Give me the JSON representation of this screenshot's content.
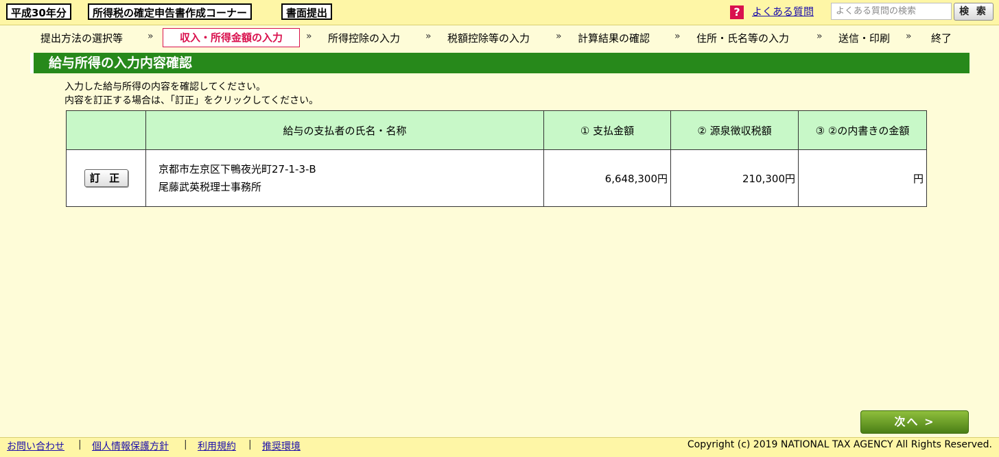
{
  "header": {
    "tags": [
      "平成30年分",
      "所得税の確定申告書作成コーナー",
      "書面提出"
    ],
    "help_icon": "question-mark-icon",
    "help_symbol": "?",
    "faq_link": "よくある質問",
    "search_placeholder": "よくある質問の検索",
    "search_button": "検 索"
  },
  "steps": [
    "提出方法の選択等",
    "収入・所得金額の入力",
    "所得控除の入力",
    "税額控除等の入力",
    "計算結果の確認",
    "住所・氏名等の入力",
    "送信・印刷",
    "終了"
  ],
  "current_step_index": 1,
  "step_separator": "»",
  "section": {
    "title": "給与所得の入力内容確認",
    "instructions": [
      "入力した給与所得の内容を確認してください。",
      "内容を訂正する場合は、「訂正」をクリックしてください。"
    ]
  },
  "table": {
    "headers": [
      "",
      "給与の支払者の氏名・名称",
      "① 支払金額",
      "② 源泉徴収税額",
      "③ ②の内書きの金額"
    ],
    "rows": [
      {
        "edit_label": "訂 正",
        "payer_address": "京都市左京区下鴨夜光町27-1-3-B",
        "payer_name": "尾藤武英税理士事務所",
        "payment": "6,648,300円",
        "withholding": "210,300円",
        "inner_amount": "円"
      }
    ]
  },
  "next_button": "次へ >",
  "footer": {
    "links": [
      "お問い合わせ",
      "個人情報保護方針",
      "利用規約",
      "推奨環境"
    ],
    "separator": "|",
    "copyright": "Copyright (c) 2019 NATIONAL TAX AGENCY All Rights Reserved."
  },
  "colors": {
    "background": "#fefcd8",
    "header_bar": "#fef6a6",
    "accent_red": "#d9114e",
    "section_green": "#27891b",
    "table_header": "#c8f8c8"
  }
}
